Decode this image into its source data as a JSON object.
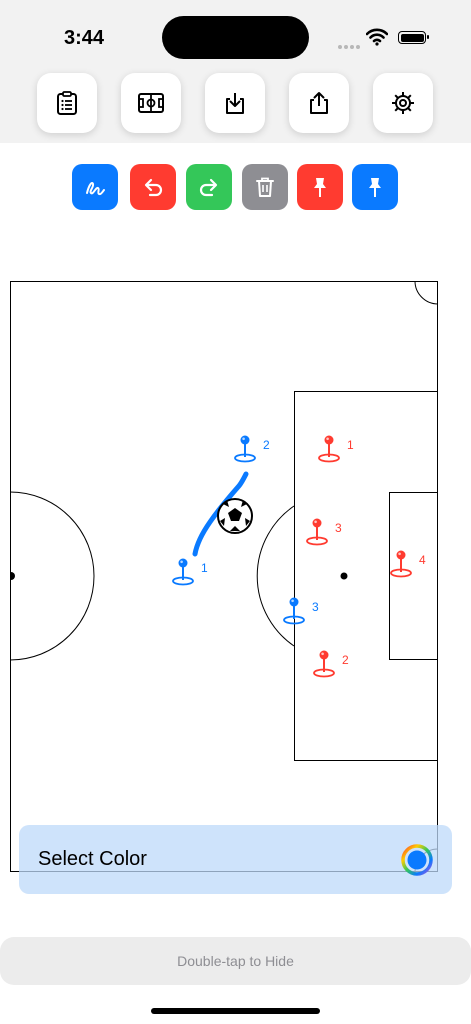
{
  "status_bar": {
    "time": "3:44"
  },
  "toolbar": {
    "buttons": [
      {
        "name": "clipboard-list-icon"
      },
      {
        "name": "soccer-field-icon"
      },
      {
        "name": "download-icon"
      },
      {
        "name": "share-icon"
      },
      {
        "name": "gear-icon"
      }
    ]
  },
  "tools": [
    {
      "name": "draw-icon",
      "color": "#0A7AFF"
    },
    {
      "name": "undo-icon",
      "color": "#FF3B30"
    },
    {
      "name": "redo-icon",
      "color": "#34C759"
    },
    {
      "name": "trash-icon",
      "color": "#8E8E93"
    },
    {
      "name": "red-pin-icon",
      "color": "#FF3B30"
    },
    {
      "name": "blue-pin-icon",
      "color": "#0A7AFF"
    }
  ],
  "colors": {
    "team_blue": "#0A7AFF",
    "team_red": "#FF3B30",
    "lines": "#000000"
  },
  "field": {
    "blue_players": [
      {
        "label": "1"
      },
      {
        "label": "2"
      },
      {
        "label": "3"
      }
    ],
    "red_players": [
      {
        "label": "1"
      },
      {
        "label": "2"
      },
      {
        "label": "3"
      },
      {
        "label": "4"
      }
    ]
  },
  "color_picker": {
    "label": "Select Color",
    "selected_color": "#0A7AFF"
  },
  "hide_hint": "Double-tap to Hide"
}
